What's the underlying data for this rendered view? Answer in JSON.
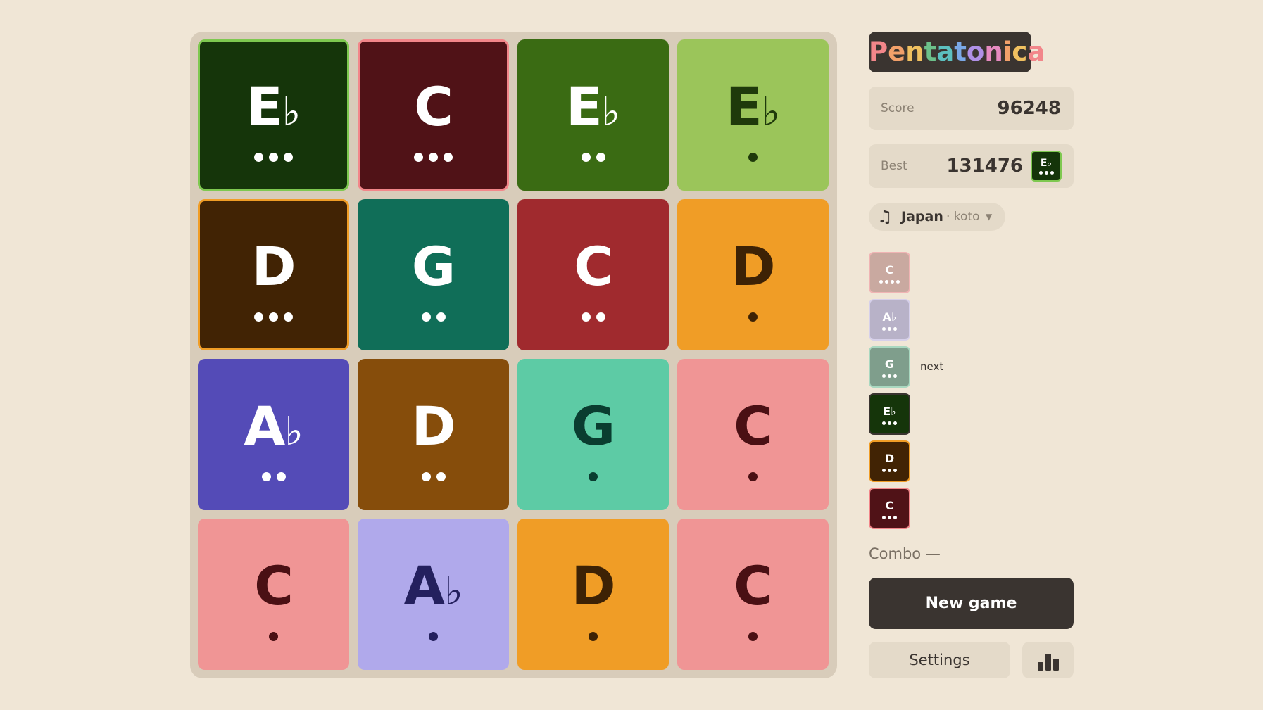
{
  "app": {
    "title": "Pentatonica",
    "title_colors": [
      "#f2868a",
      "#f2a06a",
      "#f0c060",
      "#6cc08a",
      "#5cc0c0",
      "#7aa8e6",
      "#b090e6",
      "#e68ac0",
      "#f2a06a",
      "#f0c060",
      "#f2868a"
    ]
  },
  "board": {
    "tiles": [
      {
        "note": "E",
        "acc": "♭",
        "level": 3,
        "bg": "#15350a",
        "fg": "#ffffff",
        "border": "#7ec850"
      },
      {
        "note": "C",
        "acc": "",
        "level": 3,
        "bg": "#501217",
        "fg": "#ffffff",
        "border": "#f2868a"
      },
      {
        "note": "E",
        "acc": "♭",
        "level": 2,
        "bg": "#3a6b13",
        "fg": "#ffffff",
        "border": ""
      },
      {
        "note": "E",
        "acc": "♭",
        "level": 1,
        "bg": "#9bc55a",
        "fg": "#1f3a0b",
        "border": ""
      },
      {
        "note": "D",
        "acc": "",
        "level": 3,
        "bg": "#412304",
        "fg": "#ffffff",
        "border": "#f09d26"
      },
      {
        "note": "G",
        "acc": "",
        "level": 2,
        "bg": "#106e58",
        "fg": "#ffffff",
        "border": ""
      },
      {
        "note": "C",
        "acc": "",
        "level": 2,
        "bg": "#a02a2e",
        "fg": "#ffffff",
        "border": ""
      },
      {
        "note": "D",
        "acc": "",
        "level": 1,
        "bg": "#f09d26",
        "fg": "#3d2205",
        "border": ""
      },
      {
        "note": "A",
        "acc": "♭",
        "level": 2,
        "bg": "#544bb7",
        "fg": "#ffffff",
        "border": ""
      },
      {
        "note": "D",
        "acc": "",
        "level": 2,
        "bg": "#864d0b",
        "fg": "#ffffff",
        "border": ""
      },
      {
        "note": "G",
        "acc": "",
        "level": 1,
        "bg": "#5dcba5",
        "fg": "#0a3d30",
        "border": ""
      },
      {
        "note": "C",
        "acc": "",
        "level": 1,
        "bg": "#f09595",
        "fg": "#4a1014",
        "border": ""
      },
      {
        "note": "C",
        "acc": "",
        "level": 1,
        "bg": "#f09595",
        "fg": "#4a1014",
        "border": ""
      },
      {
        "note": "A",
        "acc": "♭",
        "level": 1,
        "bg": "#b0a9eb",
        "fg": "#24205e",
        "border": ""
      },
      {
        "note": "D",
        "acc": "",
        "level": 1,
        "bg": "#f09d26",
        "fg": "#3d2205",
        "border": ""
      },
      {
        "note": "C",
        "acc": "",
        "level": 1,
        "bg": "#f09595",
        "fg": "#4a1014",
        "border": ""
      }
    ]
  },
  "score": {
    "label": "Score",
    "value": "96248"
  },
  "best": {
    "label": "Best",
    "value": "131476",
    "tile_note": "E♭",
    "tile_level": 3
  },
  "instrument": {
    "icon": "music-note-icon",
    "glyph": "♫",
    "region": "Japan",
    "sep_sub": "· koto",
    "caret": "▼"
  },
  "queue": {
    "next_label": "next",
    "items": [
      {
        "note": "C",
        "level": 4,
        "bg": "#c9a9a0",
        "border": "#f0b4b4",
        "fg": "#ffffff"
      },
      {
        "note": "A♭",
        "level": 3,
        "bg": "#b8b2c8",
        "border": "#d6d0ea",
        "fg": "#ffffff"
      },
      {
        "note": "G",
        "level": 3,
        "bg": "#7f9e8c",
        "border": "#a9d8c0",
        "fg": "#ffffff"
      },
      {
        "note": "E♭",
        "level": 3,
        "bg": "#15350a",
        "border": "#3a3430",
        "fg": "#ffffff"
      },
      {
        "note": "D",
        "level": 3,
        "bg": "#412304",
        "border": "#f09d26",
        "fg": "#ffffff"
      },
      {
        "note": "C",
        "level": 3,
        "bg": "#501217",
        "border": "#f2868a",
        "fg": "#ffffff"
      }
    ]
  },
  "combo": {
    "label": "Combo —"
  },
  "buttons": {
    "new_game": "New game",
    "settings": "Settings",
    "stats_icon": "bar-chart-icon"
  }
}
